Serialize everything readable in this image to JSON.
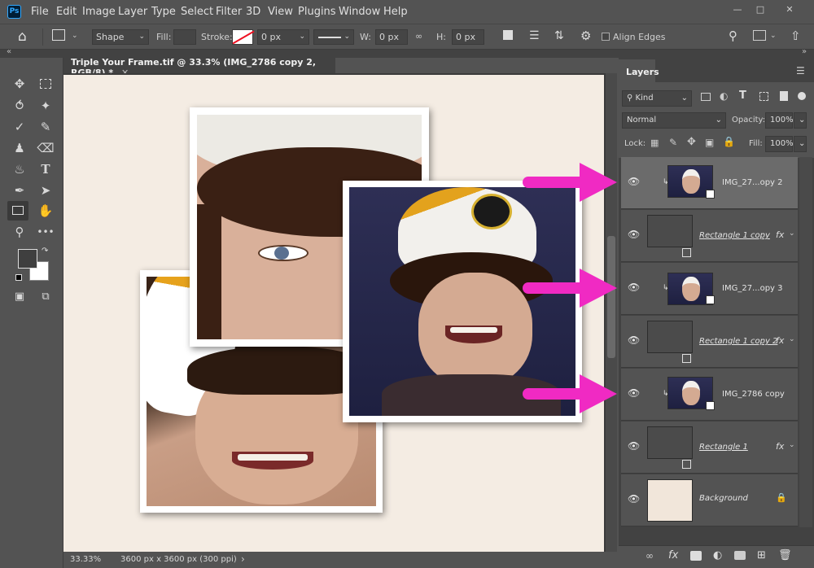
{
  "menu": [
    "File",
    "Edit",
    "Image",
    "Layer",
    "Type",
    "Select",
    "Filter",
    "3D",
    "View",
    "Plugins",
    "Window",
    "Help"
  ],
  "app_logo": "Ps",
  "options": {
    "shape_mode": "Shape",
    "fill_label": "Fill:",
    "stroke_label": "Stroke:",
    "stroke_width": "0 px",
    "w_label": "W:",
    "w_value": "0 px",
    "h_label": "H:",
    "h_value": "0 px",
    "align_edges_label": "Align Edges"
  },
  "document": {
    "tab_title": "Triple Your Frame.tif @ 33.3% (IMG_2786 copy 2, RGB/8) *",
    "zoom": "33.33%",
    "doc_info": "3600 px x 3600 px (300 ppi)"
  },
  "layers_panel": {
    "tab": "Layers",
    "filter_kind": "Kind",
    "blend_mode": "Normal",
    "opacity_label": "Opacity:",
    "opacity_value": "100%",
    "lock_label": "Lock:",
    "fill_label": "Fill:",
    "fill_value": "100%",
    "layers": [
      {
        "name": "IMG_27...opy 2",
        "type": "smart-object-clipped",
        "selected": true
      },
      {
        "name": "Rectangle 1 copy",
        "type": "shape",
        "fx": true
      },
      {
        "name": "IMG_27...opy 3",
        "type": "smart-object-clipped"
      },
      {
        "name": "Rectangle 1 copy 2",
        "type": "shape",
        "fx": true
      },
      {
        "name": "IMG_2786 copy",
        "type": "smart-object-clipped"
      },
      {
        "name": "Rectangle 1",
        "type": "shape",
        "fx": true
      },
      {
        "name": "Background",
        "type": "background",
        "locked": true
      }
    ]
  },
  "colors": {
    "accent_arrow": "#f02ac3",
    "panel": "#535353",
    "canvas": "#f4ece3"
  }
}
